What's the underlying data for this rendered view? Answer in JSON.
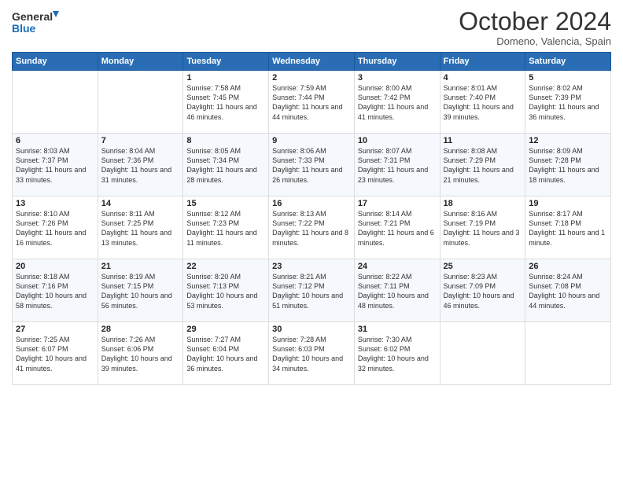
{
  "logo": {
    "line1": "General",
    "line2": "Blue"
  },
  "title": "October 2024",
  "subtitle": "Domeno, Valencia, Spain",
  "days_of_week": [
    "Sunday",
    "Monday",
    "Tuesday",
    "Wednesday",
    "Thursday",
    "Friday",
    "Saturday"
  ],
  "weeks": [
    [
      {
        "day": "",
        "detail": ""
      },
      {
        "day": "",
        "detail": ""
      },
      {
        "day": "1",
        "detail": "Sunrise: 7:58 AM\nSunset: 7:45 PM\nDaylight: 11 hours and 46 minutes."
      },
      {
        "day": "2",
        "detail": "Sunrise: 7:59 AM\nSunset: 7:44 PM\nDaylight: 11 hours and 44 minutes."
      },
      {
        "day": "3",
        "detail": "Sunrise: 8:00 AM\nSunset: 7:42 PM\nDaylight: 11 hours and 41 minutes."
      },
      {
        "day": "4",
        "detail": "Sunrise: 8:01 AM\nSunset: 7:40 PM\nDaylight: 11 hours and 39 minutes."
      },
      {
        "day": "5",
        "detail": "Sunrise: 8:02 AM\nSunset: 7:39 PM\nDaylight: 11 hours and 36 minutes."
      }
    ],
    [
      {
        "day": "6",
        "detail": "Sunrise: 8:03 AM\nSunset: 7:37 PM\nDaylight: 11 hours and 33 minutes."
      },
      {
        "day": "7",
        "detail": "Sunrise: 8:04 AM\nSunset: 7:36 PM\nDaylight: 11 hours and 31 minutes."
      },
      {
        "day": "8",
        "detail": "Sunrise: 8:05 AM\nSunset: 7:34 PM\nDaylight: 11 hours and 28 minutes."
      },
      {
        "day": "9",
        "detail": "Sunrise: 8:06 AM\nSunset: 7:33 PM\nDaylight: 11 hours and 26 minutes."
      },
      {
        "day": "10",
        "detail": "Sunrise: 8:07 AM\nSunset: 7:31 PM\nDaylight: 11 hours and 23 minutes."
      },
      {
        "day": "11",
        "detail": "Sunrise: 8:08 AM\nSunset: 7:29 PM\nDaylight: 11 hours and 21 minutes."
      },
      {
        "day": "12",
        "detail": "Sunrise: 8:09 AM\nSunset: 7:28 PM\nDaylight: 11 hours and 18 minutes."
      }
    ],
    [
      {
        "day": "13",
        "detail": "Sunrise: 8:10 AM\nSunset: 7:26 PM\nDaylight: 11 hours and 16 minutes."
      },
      {
        "day": "14",
        "detail": "Sunrise: 8:11 AM\nSunset: 7:25 PM\nDaylight: 11 hours and 13 minutes."
      },
      {
        "day": "15",
        "detail": "Sunrise: 8:12 AM\nSunset: 7:23 PM\nDaylight: 11 hours and 11 minutes."
      },
      {
        "day": "16",
        "detail": "Sunrise: 8:13 AM\nSunset: 7:22 PM\nDaylight: 11 hours and 8 minutes."
      },
      {
        "day": "17",
        "detail": "Sunrise: 8:14 AM\nSunset: 7:21 PM\nDaylight: 11 hours and 6 minutes."
      },
      {
        "day": "18",
        "detail": "Sunrise: 8:16 AM\nSunset: 7:19 PM\nDaylight: 11 hours and 3 minutes."
      },
      {
        "day": "19",
        "detail": "Sunrise: 8:17 AM\nSunset: 7:18 PM\nDaylight: 11 hours and 1 minute."
      }
    ],
    [
      {
        "day": "20",
        "detail": "Sunrise: 8:18 AM\nSunset: 7:16 PM\nDaylight: 10 hours and 58 minutes."
      },
      {
        "day": "21",
        "detail": "Sunrise: 8:19 AM\nSunset: 7:15 PM\nDaylight: 10 hours and 56 minutes."
      },
      {
        "day": "22",
        "detail": "Sunrise: 8:20 AM\nSunset: 7:13 PM\nDaylight: 10 hours and 53 minutes."
      },
      {
        "day": "23",
        "detail": "Sunrise: 8:21 AM\nSunset: 7:12 PM\nDaylight: 10 hours and 51 minutes."
      },
      {
        "day": "24",
        "detail": "Sunrise: 8:22 AM\nSunset: 7:11 PM\nDaylight: 10 hours and 48 minutes."
      },
      {
        "day": "25",
        "detail": "Sunrise: 8:23 AM\nSunset: 7:09 PM\nDaylight: 10 hours and 46 minutes."
      },
      {
        "day": "26",
        "detail": "Sunrise: 8:24 AM\nSunset: 7:08 PM\nDaylight: 10 hours and 44 minutes."
      }
    ],
    [
      {
        "day": "27",
        "detail": "Sunrise: 7:25 AM\nSunset: 6:07 PM\nDaylight: 10 hours and 41 minutes."
      },
      {
        "day": "28",
        "detail": "Sunrise: 7:26 AM\nSunset: 6:06 PM\nDaylight: 10 hours and 39 minutes."
      },
      {
        "day": "29",
        "detail": "Sunrise: 7:27 AM\nSunset: 6:04 PM\nDaylight: 10 hours and 36 minutes."
      },
      {
        "day": "30",
        "detail": "Sunrise: 7:28 AM\nSunset: 6:03 PM\nDaylight: 10 hours and 34 minutes."
      },
      {
        "day": "31",
        "detail": "Sunrise: 7:30 AM\nSunset: 6:02 PM\nDaylight: 10 hours and 32 minutes."
      },
      {
        "day": "",
        "detail": ""
      },
      {
        "day": "",
        "detail": ""
      }
    ]
  ]
}
